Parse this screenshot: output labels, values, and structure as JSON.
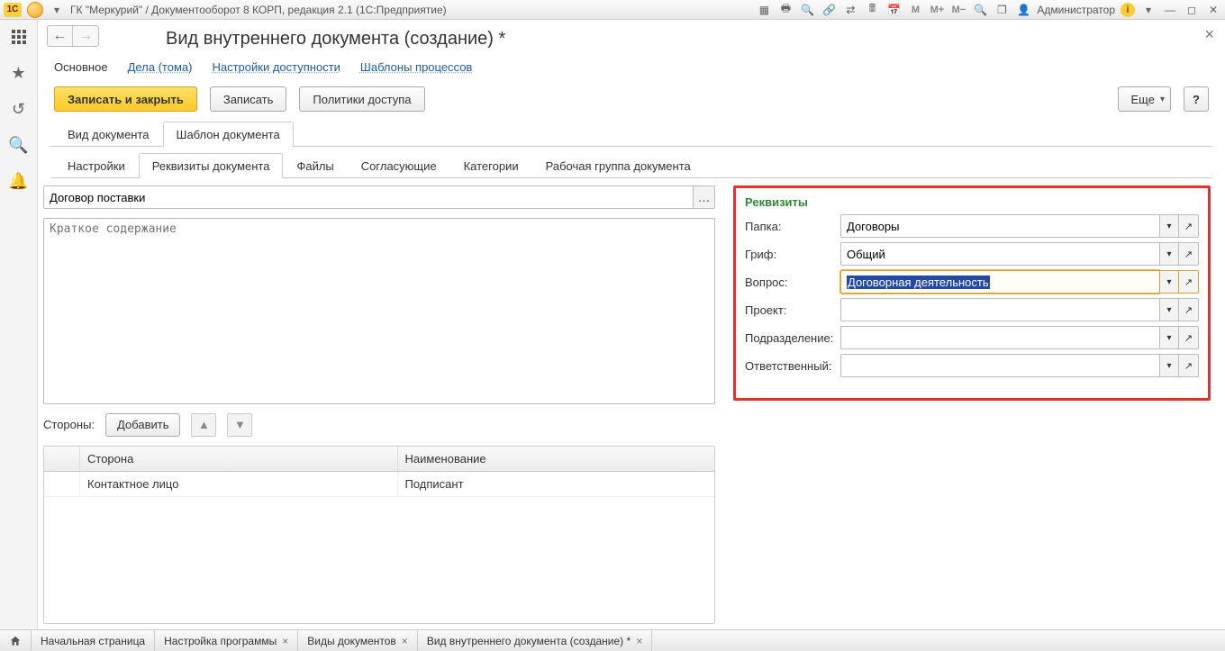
{
  "window": {
    "title": "ГК \"Меркурий\" / Документооборот 8 КОРП, редакция 2.1  (1С:Предприятие)",
    "user": "Администратор"
  },
  "page": {
    "title": "Вид внутреннего документа (создание) *",
    "nav": [
      "Основное",
      "Дела (тома)",
      "Настройки доступности",
      "Шаблоны процессов"
    ],
    "nav_active_index": 0
  },
  "toolbar": {
    "save_close": "Записать и закрыть",
    "save": "Записать",
    "policies": "Политики доступа",
    "more": "Еще",
    "help": "?"
  },
  "tabs_outer": {
    "items": [
      "Вид документа",
      "Шаблон документа"
    ],
    "active": 1
  },
  "tabs_inner": {
    "items": [
      "Настройки",
      "Реквизиты документа",
      "Файлы",
      "Согласующие",
      "Категории",
      "Рабочая группа документа"
    ],
    "active": 1
  },
  "form": {
    "name_value": "Договор поставки",
    "summary_placeholder": "Краткое содержание",
    "sides_label": "Стороны:",
    "add_btn": "Добавить"
  },
  "grid": {
    "columns": [
      "",
      "Сторона",
      "Наименование"
    ],
    "rows": [
      {
        "c1": "Контактное лицо",
        "c2": "Подписант"
      }
    ]
  },
  "requisites": {
    "title": "Реквизиты",
    "fields": [
      {
        "label": "Папка:",
        "value": "Договоры"
      },
      {
        "label": "Гриф:",
        "value": "Общий"
      },
      {
        "label": "Вопрос:",
        "value": "Договорная деятельность",
        "focused": true,
        "selected": true
      },
      {
        "label": "Проект:",
        "value": ""
      },
      {
        "label": "Подразделение:",
        "value": "",
        "caret": true
      },
      {
        "label": "Ответственный:",
        "value": ""
      }
    ]
  },
  "taskbar": {
    "home": "Начальная страница",
    "tabs": [
      "Настройка программы",
      "Виды документов",
      "Вид внутреннего документа (создание) *"
    ]
  }
}
